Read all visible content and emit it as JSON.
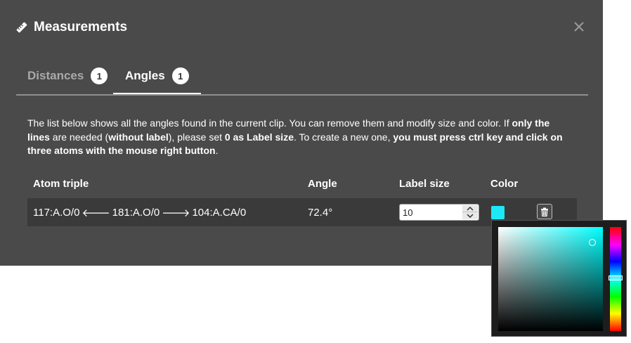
{
  "dialog": {
    "title": "Measurements",
    "title_icon": "ruler-icon",
    "close_icon": "close-icon",
    "background": "#4a4a4a"
  },
  "tabs": [
    {
      "label": "Distances",
      "count": "1",
      "active": false
    },
    {
      "label": "Angles",
      "count": "1",
      "active": true
    }
  ],
  "description": {
    "p1": "The list below shows all the angles found in the current clip. You can remove them and modify size and color. If ",
    "b1": "only the lines",
    "p2": " are needed (",
    "b2": "without label",
    "p3": "), please set ",
    "b3": "0 as Label size",
    "p4": ". To create a new one, ",
    "b4": "you must press ctrl key and click on three atoms with the mouse right button",
    "p5": "."
  },
  "table": {
    "headers": {
      "atom_triple": "Atom triple",
      "angle": "Angle",
      "label_size": "Label size",
      "color": "Color"
    },
    "rows": [
      {
        "atom1": "117:A.O/0",
        "arrow_left": "🡐",
        "atom2": "181:A.O/0",
        "arrow_right": "🡒",
        "atom3": "104:A.CA/0",
        "angle": "72.4°",
        "label_size": "10",
        "color": "#1de9f6",
        "delete_icon": "trash-icon"
      }
    ]
  },
  "color_picker": {
    "hue_color": "#00ffff",
    "selected_color": "#1de9f6",
    "saturation": 0.9,
    "value": 0.85,
    "hue_fraction": 0.49
  }
}
